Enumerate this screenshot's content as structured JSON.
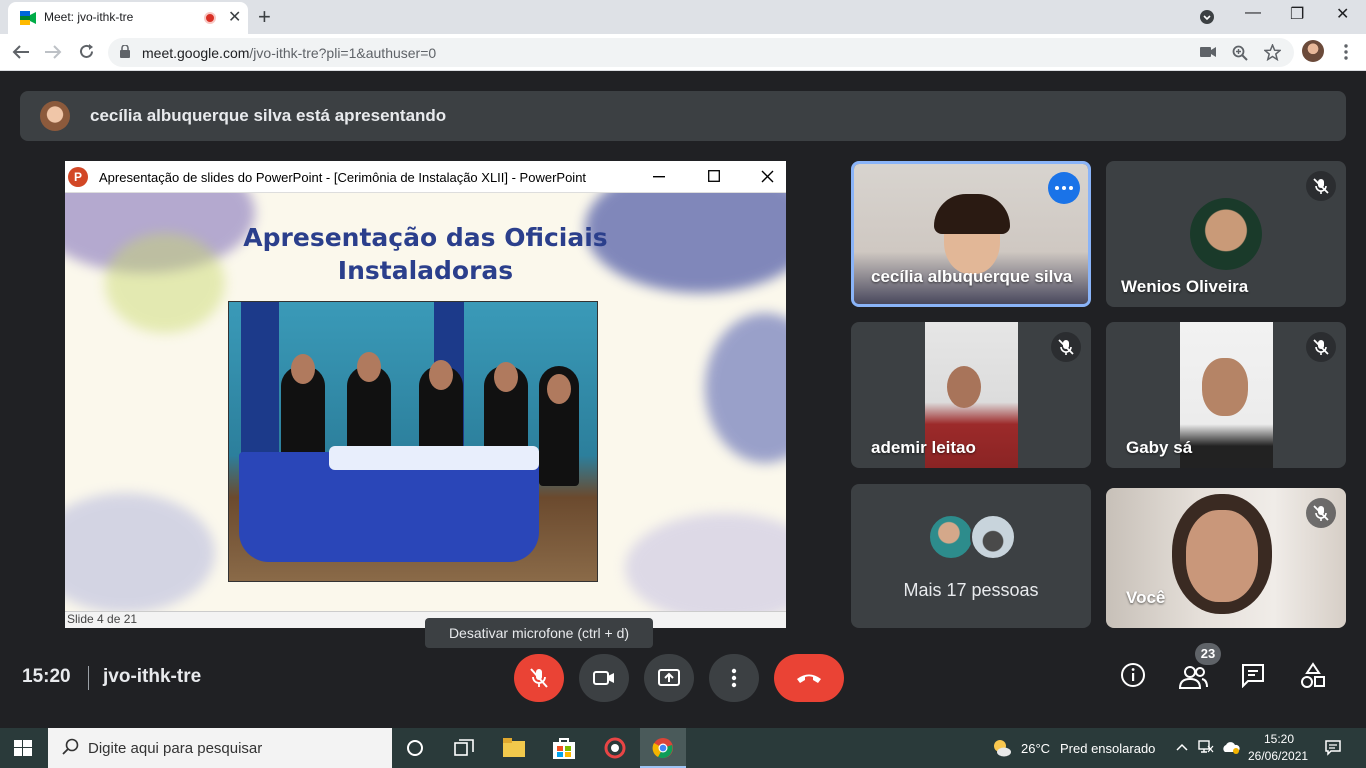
{
  "browser": {
    "tab_title": "Meet: jvo-ithk-tre",
    "url_host": "meet.google.com",
    "url_path": "/jvo-ithk-tre?pli=1&authuser=0",
    "new_tab_symbol": "+",
    "close_tab_symbol": "✕",
    "minimize_symbol": "—",
    "maximize_symbol": "❐",
    "close_window_symbol": "✕"
  },
  "banner": {
    "presenter_text": "cecília albuquerque silva está apresentando"
  },
  "presentation": {
    "window_title": "Apresentação de slides do PowerPoint - [Cerimônia de Instalação XLII] - PowerPoint",
    "slide_title_line1": "Apresentação das Oficiais",
    "slide_title_line2": "Instaladoras",
    "slide_counter": "Slide 4 de 21",
    "app_icon_letter": "P"
  },
  "participants": [
    {
      "name": "cecília albuquerque silva",
      "muted": false,
      "active": true
    },
    {
      "name": "Wenios Oliveira",
      "muted": true
    },
    {
      "name": "ademir leitao",
      "muted": true
    },
    {
      "name": "Gaby sá",
      "muted": true
    },
    {
      "name": "Mais 17 pessoas"
    },
    {
      "name": "Você",
      "muted": true
    }
  ],
  "tooltip": {
    "text": "Desativar microfone (ctrl + d)"
  },
  "meeting": {
    "time": "15:20",
    "code": "jvo-ithk-tre",
    "people_count": "23"
  },
  "taskbar": {
    "search_placeholder": "Digite aqui para pesquisar",
    "temperature": "26°C",
    "weather": "Pred ensolarado",
    "time": "15:20",
    "date": "26/06/2021"
  },
  "colors": {
    "meet_background": "#202124",
    "tile_background": "#3c4043",
    "accent_blue": "#8ab4f8",
    "hangup_red": "#ea4335",
    "slide_title_blue": "#2b3f8c"
  }
}
